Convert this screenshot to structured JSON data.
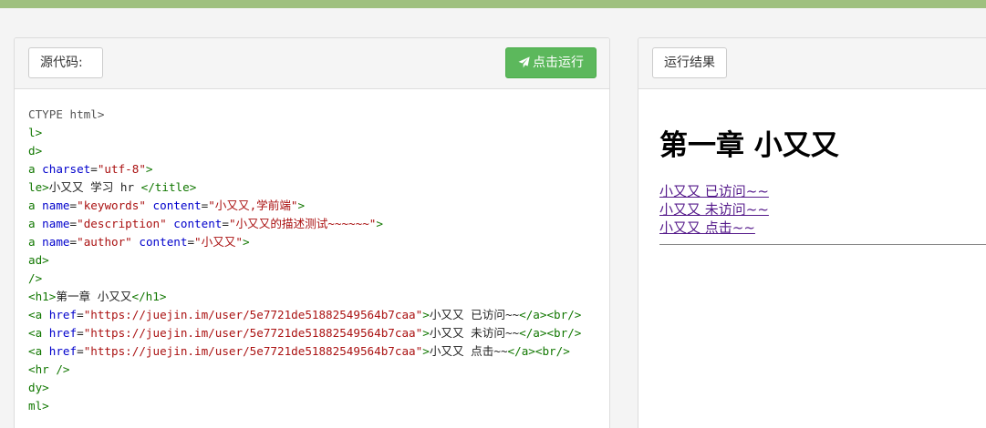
{
  "source_panel": {
    "title_label": "源代码:",
    "run_button_label": "点击运行",
    "code_lines": [
      {
        "parts": [
          {
            "c": "dt",
            "t": "CTYPE html>"
          }
        ]
      },
      {
        "parts": [
          {
            "c": "tg",
            "t": "l>"
          }
        ]
      },
      {
        "parts": [
          {
            "c": "tg",
            "t": "d>"
          }
        ]
      },
      {
        "parts": [
          {
            "c": "tg",
            "t": "a "
          },
          {
            "c": "at",
            "t": "charset"
          },
          {
            "c": "tx",
            "t": "="
          },
          {
            "c": "st",
            "t": "\"utf-8\""
          },
          {
            "c": "tg",
            "t": ">"
          }
        ]
      },
      {
        "parts": [
          {
            "c": "tg",
            "t": "le>"
          },
          {
            "c": "tx",
            "t": "小又又 学习 hr "
          },
          {
            "c": "tg",
            "t": "</title>"
          }
        ]
      },
      {
        "parts": [
          {
            "c": "tg",
            "t": "a "
          },
          {
            "c": "at",
            "t": "name"
          },
          {
            "c": "tx",
            "t": "="
          },
          {
            "c": "st",
            "t": "\"keywords\""
          },
          {
            "c": "tx",
            "t": " "
          },
          {
            "c": "at",
            "t": "content"
          },
          {
            "c": "tx",
            "t": "="
          },
          {
            "c": "st",
            "t": "\"小又又,学前端\""
          },
          {
            "c": "tg",
            "t": ">"
          }
        ]
      },
      {
        "parts": [
          {
            "c": "tg",
            "t": "a "
          },
          {
            "c": "at",
            "t": "name"
          },
          {
            "c": "tx",
            "t": "="
          },
          {
            "c": "st",
            "t": "\"description\""
          },
          {
            "c": "tx",
            "t": " "
          },
          {
            "c": "at",
            "t": "content"
          },
          {
            "c": "tx",
            "t": "="
          },
          {
            "c": "st",
            "t": "\"小又又的描述测试~~~~~~\""
          },
          {
            "c": "tg",
            "t": ">"
          }
        ]
      },
      {
        "parts": [
          {
            "c": "tg",
            "t": "a "
          },
          {
            "c": "at",
            "t": "name"
          },
          {
            "c": "tx",
            "t": "="
          },
          {
            "c": "st",
            "t": "\"author\""
          },
          {
            "c": "tx",
            "t": " "
          },
          {
            "c": "at",
            "t": "content"
          },
          {
            "c": "tx",
            "t": "="
          },
          {
            "c": "st",
            "t": "\"小又又\""
          },
          {
            "c": "tg",
            "t": ">"
          }
        ]
      },
      {
        "parts": [
          {
            "c": "tg",
            "t": "ad>"
          }
        ]
      },
      {
        "parts": [
          {
            "c": "tg",
            "t": "/>"
          }
        ]
      },
      {
        "parts": [
          {
            "c": "tg",
            "t": "<h1>"
          },
          {
            "c": "tx",
            "t": "第一章 小又又"
          },
          {
            "c": "tg",
            "t": "</h1>"
          }
        ]
      },
      {
        "parts": [
          {
            "c": "tg",
            "t": "<a "
          },
          {
            "c": "at",
            "t": "href"
          },
          {
            "c": "tx",
            "t": "="
          },
          {
            "c": "st",
            "t": "\"https://juejin.im/user/5e7721de51882549564b7caa\""
          },
          {
            "c": "tg",
            "t": ">"
          },
          {
            "c": "tx",
            "t": "小又又 已访问~~"
          },
          {
            "c": "tg",
            "t": "</a><br/>"
          }
        ]
      },
      {
        "parts": [
          {
            "c": "tg",
            "t": "<a "
          },
          {
            "c": "at",
            "t": "href"
          },
          {
            "c": "tx",
            "t": "="
          },
          {
            "c": "st",
            "t": "\"https://juejin.im/user/5e7721de51882549564b7caa\""
          },
          {
            "c": "tg",
            "t": ">"
          },
          {
            "c": "tx",
            "t": "小又又 未访问~~"
          },
          {
            "c": "tg",
            "t": "</a><br/>"
          }
        ]
      },
      {
        "parts": [
          {
            "c": "tg",
            "t": "<a "
          },
          {
            "c": "at",
            "t": "href"
          },
          {
            "c": "tx",
            "t": "="
          },
          {
            "c": "st",
            "t": "\"https://juejin.im/user/5e7721de51882549564b7caa\""
          },
          {
            "c": "tg",
            "t": ">"
          },
          {
            "c": "tx",
            "t": "小又又 点击~~"
          },
          {
            "c": "tg",
            "t": "</a><br/>"
          }
        ]
      },
      {
        "parts": [
          {
            "c": "tg",
            "t": "<hr />"
          }
        ]
      },
      {
        "parts": [
          {
            "c": "tg",
            "t": "dy>"
          }
        ]
      },
      {
        "parts": [
          {
            "c": "tg",
            "t": "ml>"
          }
        ]
      }
    ]
  },
  "result_panel": {
    "title_label": "运行结果",
    "heading": "第一章 小又又",
    "links": [
      "小又又 已访问~~",
      "小又又 未访问~~",
      "小又又 点击~~"
    ]
  },
  "colors": {
    "top_bar": "#9fc07f",
    "run_button": "#5cb85c",
    "code_tag": "#117700",
    "code_attr": "#0000cc",
    "code_string": "#aa1111",
    "visited_link": "#551a8b"
  },
  "icons": {
    "run_button_icon": "paper-plane-icon"
  }
}
